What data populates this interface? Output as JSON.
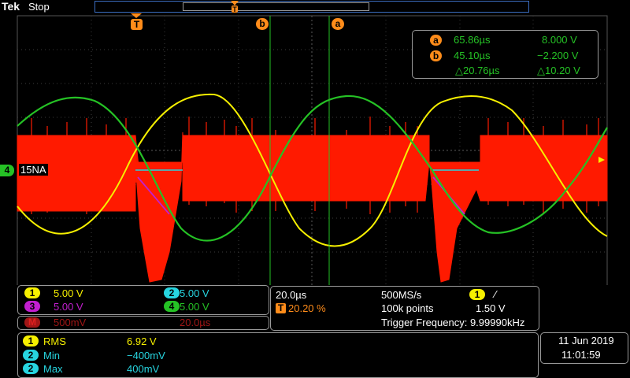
{
  "header": {
    "brand": "Tek",
    "state": "Stop"
  },
  "cursor_labels": {
    "trigger": "T",
    "a": "a",
    "b": "b"
  },
  "cursor_readout": {
    "a_time": "65.86µs",
    "a_value": "8.000 V",
    "b_time": "45.10µs",
    "b_value": "−2.200 V",
    "delta_time": "△20.76µs",
    "delta_value": "△10.20 V"
  },
  "ref_label": {
    "channel": "4",
    "text": "15NA"
  },
  "channels": [
    {
      "num": "1",
      "scale": "5.00 V",
      "color": "#f6f000"
    },
    {
      "num": "2",
      "scale": "5.00 V",
      "color": "#27d5e0"
    },
    {
      "num": "3",
      "scale": "5.00 V",
      "color": "#c21fcf"
    },
    {
      "num": "4",
      "scale": "5.00 V",
      "color": "#25c225"
    }
  ],
  "math": {
    "label": "M",
    "scale": "500mV",
    "timebase": "20.0µs"
  },
  "horizontal": {
    "time_scale": "20.0µs",
    "sample_rate": "500MS/s",
    "trigger_position": "20.20 %",
    "record_length": "100k points",
    "trigger_channel": "1",
    "trigger_slope": "⁄",
    "trigger_level": "1.50 V",
    "trigger_freq": "Trigger Frequency: 9.99990kHz"
  },
  "measurements": [
    {
      "ch": "1",
      "name": "RMS",
      "value": "6.92 V"
    },
    {
      "ch": "2",
      "name": "Min",
      "value": "−400mV"
    },
    {
      "ch": "2",
      "name": "Max",
      "value": "400mV"
    }
  ],
  "datetime": {
    "date": "11 Jun  2019",
    "time": "11:01:59"
  },
  "colors": {
    "ch1": "#f6f000",
    "ch2": "#27d5e0",
    "ch3": "#c21fcf",
    "ch4": "#25c225",
    "red_trace": "#ff0000",
    "cursor": "#25c225",
    "trigger": "#ff8c1a"
  }
}
